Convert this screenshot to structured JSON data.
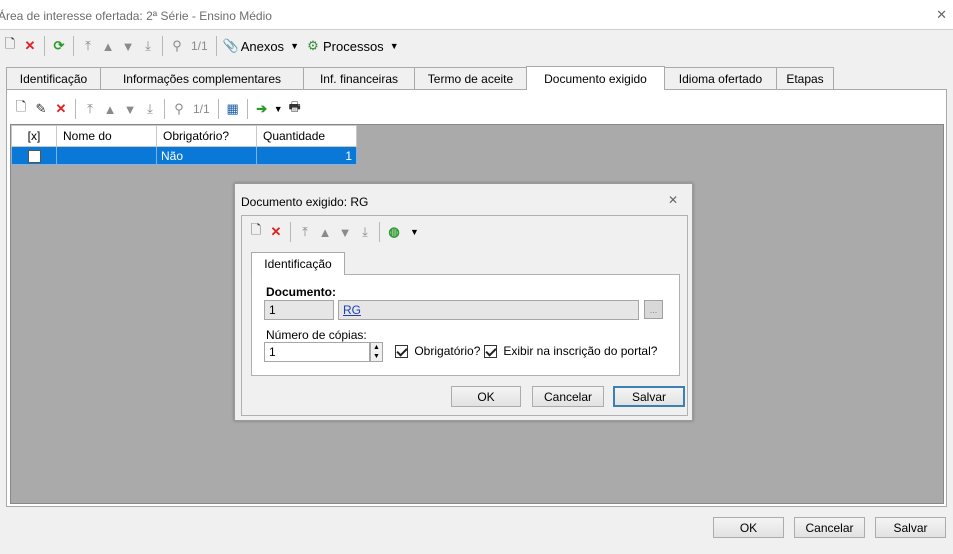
{
  "window": {
    "title": "Área de interesse ofertada: 2ª Série - Ensino Médio",
    "close_glyph": "✕"
  },
  "main_toolbar": {
    "record_count": "1/1",
    "anexos_label": "Anexos",
    "processos_label": "Processos"
  },
  "tabs": [
    {
      "label": "Identificação"
    },
    {
      "label": "Informações complementares"
    },
    {
      "label": "Inf. financeiras"
    },
    {
      "label": "Termo de aceite"
    },
    {
      "label": "Documento exigido",
      "active": true
    },
    {
      "label": "Idioma ofertado"
    },
    {
      "label": "Etapas"
    }
  ],
  "sub_toolbar": {
    "record_count": "1/1"
  },
  "grid": {
    "columns": [
      "[x]",
      "Nome do",
      "Obrigatório?",
      "Quantidade"
    ],
    "rows": [
      {
        "checked": false,
        "nome": "",
        "obrigatorio": "Não",
        "quantidade": "1"
      }
    ]
  },
  "dialog": {
    "title": "Documento exigido: RG",
    "tab_label": "Identificação",
    "documento_label": "Documento",
    "documento_code": "1",
    "documento_name": "RG",
    "lookup_button": "...",
    "copias_label": "Número de cópias:",
    "copias_value": "1",
    "obrigatorio_label": "Obrigatório?",
    "obrigatorio_checked": true,
    "exibir_label": "Exibir na inscrição do portal?",
    "exibir_checked": true,
    "ok_label": "OK",
    "cancel_label": "Cancelar",
    "save_label": "Salvar"
  },
  "footer": {
    "ok_label": "OK",
    "cancel_label": "Cancelar",
    "save_label": "Salvar"
  },
  "colors": {
    "selection": "#0a78d7",
    "grid_background": "#aaaaaa",
    "link": "#1f3fb8"
  }
}
